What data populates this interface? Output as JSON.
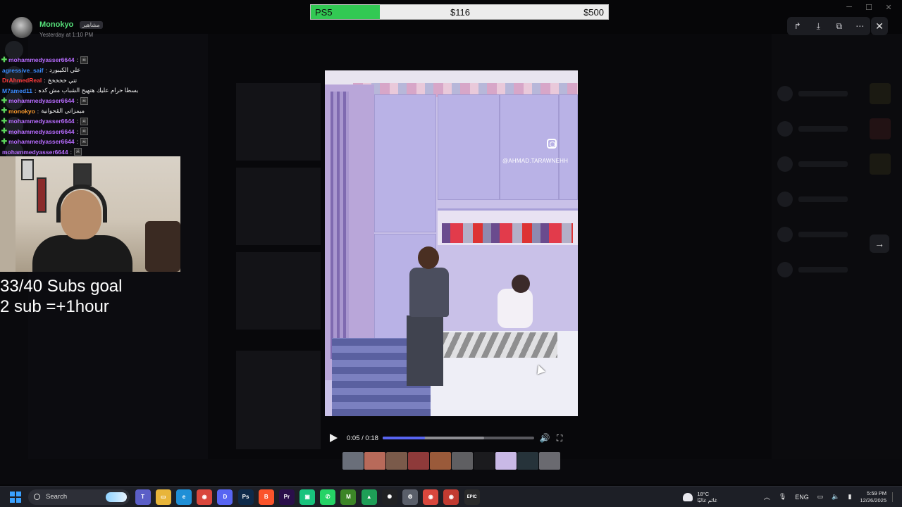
{
  "poster": {
    "name": "Monokyo",
    "tag": "مشاهير",
    "time": "Yesterday at 1:10 PM"
  },
  "goal": {
    "label": "PS5",
    "current": "$116",
    "target": "$500",
    "progress": 0.232,
    "fill_color": "#32c953"
  },
  "lightbox_toolbar": {
    "icons": [
      "share-icon",
      "download-icon",
      "open-external-icon",
      "more-icon"
    ],
    "close_icon": "close-icon",
    "next_icon": "arrow-right-icon"
  },
  "chat": [
    {
      "user": "mohammedyasser6644",
      "color": "#b86cff",
      "plus": true,
      "msg": "",
      "emote": true
    },
    {
      "user": "agressive_saif",
      "color": "#3b8cff",
      "plus": false,
      "msg": "علي الكيبورد",
      "emote": false
    },
    {
      "user": "DrAhmedReal",
      "color": "#ff3b3b",
      "plus": false,
      "msg": "تتي خخخخخ",
      "emote": false
    },
    {
      "user": "M7amed11",
      "color": "#3b8cff",
      "plus": false,
      "msg": "بسطا حرام عليك هتهيج الشباب مش كده",
      "emote": false
    },
    {
      "user": "mohammedyasser6644",
      "color": "#b86cff",
      "plus": true,
      "msg": "",
      "emote": true
    },
    {
      "user": "monokyo",
      "color": "#ff9d2e",
      "plus": true,
      "msg": "ميمزاتي القحوانية",
      "emote": false
    },
    {
      "user": "mohammedyasser6644",
      "color": "#b86cff",
      "plus": true,
      "msg": "",
      "emote": true
    },
    {
      "user": "mohammedyasser6644",
      "color": "#b86cff",
      "plus": true,
      "msg": "",
      "emote": true
    },
    {
      "user": "mohammedyasser6644",
      "color": "#b86cff",
      "plus": true,
      "msg": "",
      "emote": true
    },
    {
      "user": "mohammedyasser6644",
      "color": "#b86cff",
      "plus": false,
      "msg": "",
      "emote": true
    }
  ],
  "subs": {
    "line1": "33/40 Subs goal",
    "line2": "2 sub =+1hour"
  },
  "video": {
    "handle": "@AHMAD.TARAWNEHH",
    "watermark_icon": "instagram-icon"
  },
  "player": {
    "time": "0:05 / 0:18",
    "progress": 0.278,
    "buffered": 0.67,
    "accent": "#5865f2"
  },
  "thumbnails": [
    "#6a6f7a",
    "#b86a5a",
    "#7a5a4a",
    "#8e3a3a",
    "#9a5a3a",
    "#5f5f62",
    "#1b1b1e",
    "#c9b9e6",
    "#26333a",
    "#6a6a70"
  ],
  "taskbar": {
    "search_label": "Search",
    "apps": [
      {
        "name": "teams-icon",
        "color": "#5b5fc7",
        "glyph": "T"
      },
      {
        "name": "file-explorer-icon",
        "color": "#e8b53a",
        "glyph": "▭"
      },
      {
        "name": "edge-icon",
        "color": "#1f8fd6",
        "glyph": "e"
      },
      {
        "name": "chrome-icon",
        "color": "#d9473d",
        "glyph": "◉"
      },
      {
        "name": "discord-icon",
        "color": "#5865f2",
        "glyph": "D"
      },
      {
        "name": "photoshop-icon",
        "color": "#0e2a4a",
        "glyph": "Ps"
      },
      {
        "name": "brave-icon",
        "color": "#fb542b",
        "glyph": "B"
      },
      {
        "name": "premiere-icon",
        "color": "#2a0f4a",
        "glyph": "Pr"
      },
      {
        "name": "chat-app-icon",
        "color": "#19c37d",
        "glyph": "▣"
      },
      {
        "name": "whatsapp-icon",
        "color": "#25d366",
        "glyph": "✆"
      },
      {
        "name": "minecraft-icon",
        "color": "#3c8527",
        "glyph": "M"
      },
      {
        "name": "green-app-icon",
        "color": "#1e9e57",
        "glyph": "▲"
      },
      {
        "name": "openai-icon",
        "color": "#202123",
        "glyph": "✺"
      },
      {
        "name": "settings-icon",
        "color": "#5a5f6a",
        "glyph": "⚙"
      },
      {
        "name": "chrome-2-icon",
        "color": "#d9473d",
        "glyph": "◉"
      },
      {
        "name": "chrome-3-icon",
        "color": "#c23b31",
        "glyph": "◉"
      },
      {
        "name": "epic-games-icon",
        "color": "#2a2a2a",
        "glyph": "EPIC"
      }
    ],
    "weather_temp": "18°C",
    "weather_desc": "غائم غالبًا",
    "lang": "ENG",
    "time": "5:59 PM",
    "date": "12/26/2025"
  }
}
